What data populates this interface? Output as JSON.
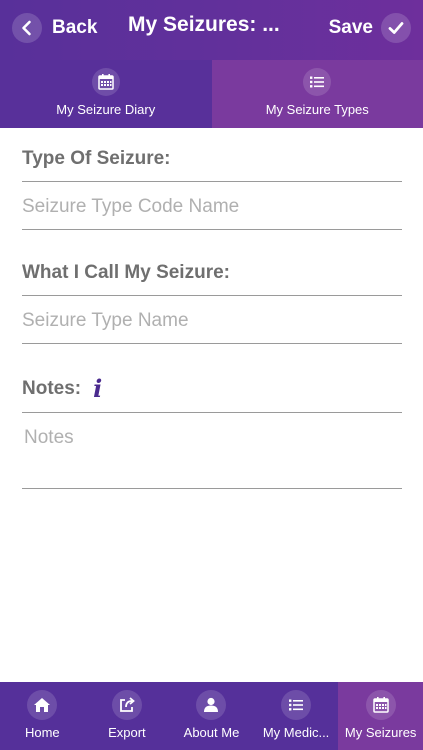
{
  "header": {
    "back_label": "Back",
    "title": "My Seizures: ...",
    "save_label": "Save"
  },
  "tabs": [
    {
      "label": "My Seizure Diary",
      "icon": "calendar-icon",
      "active": false
    },
    {
      "label": "My Seizure Types",
      "icon": "list-icon",
      "active": true
    }
  ],
  "form": {
    "type_label": "Type Of Seizure:",
    "type_placeholder": "Seizure Type Code Name",
    "call_label": "What I Call My Seizure:",
    "call_placeholder": "Seizure Type Name",
    "notes_label": "Notes:",
    "notes_info_glyph": "i",
    "notes_placeholder": "Notes"
  },
  "tabbar": [
    {
      "label": "Home",
      "icon": "home-icon",
      "active": false
    },
    {
      "label": "Export",
      "icon": "export-icon",
      "active": false
    },
    {
      "label": "About Me",
      "icon": "person-icon",
      "active": false
    },
    {
      "label": "My Medic...",
      "icon": "list-icon",
      "active": false
    },
    {
      "label": "My Seizures",
      "icon": "calendar-icon",
      "active": true
    }
  ],
  "colors": {
    "header_purple": "#58309a",
    "active_tab_purple": "#7a3a9e",
    "label_gray": "#6f6f6f",
    "placeholder_gray": "#b0b0b0",
    "info_icon": "#4a2a8e"
  }
}
